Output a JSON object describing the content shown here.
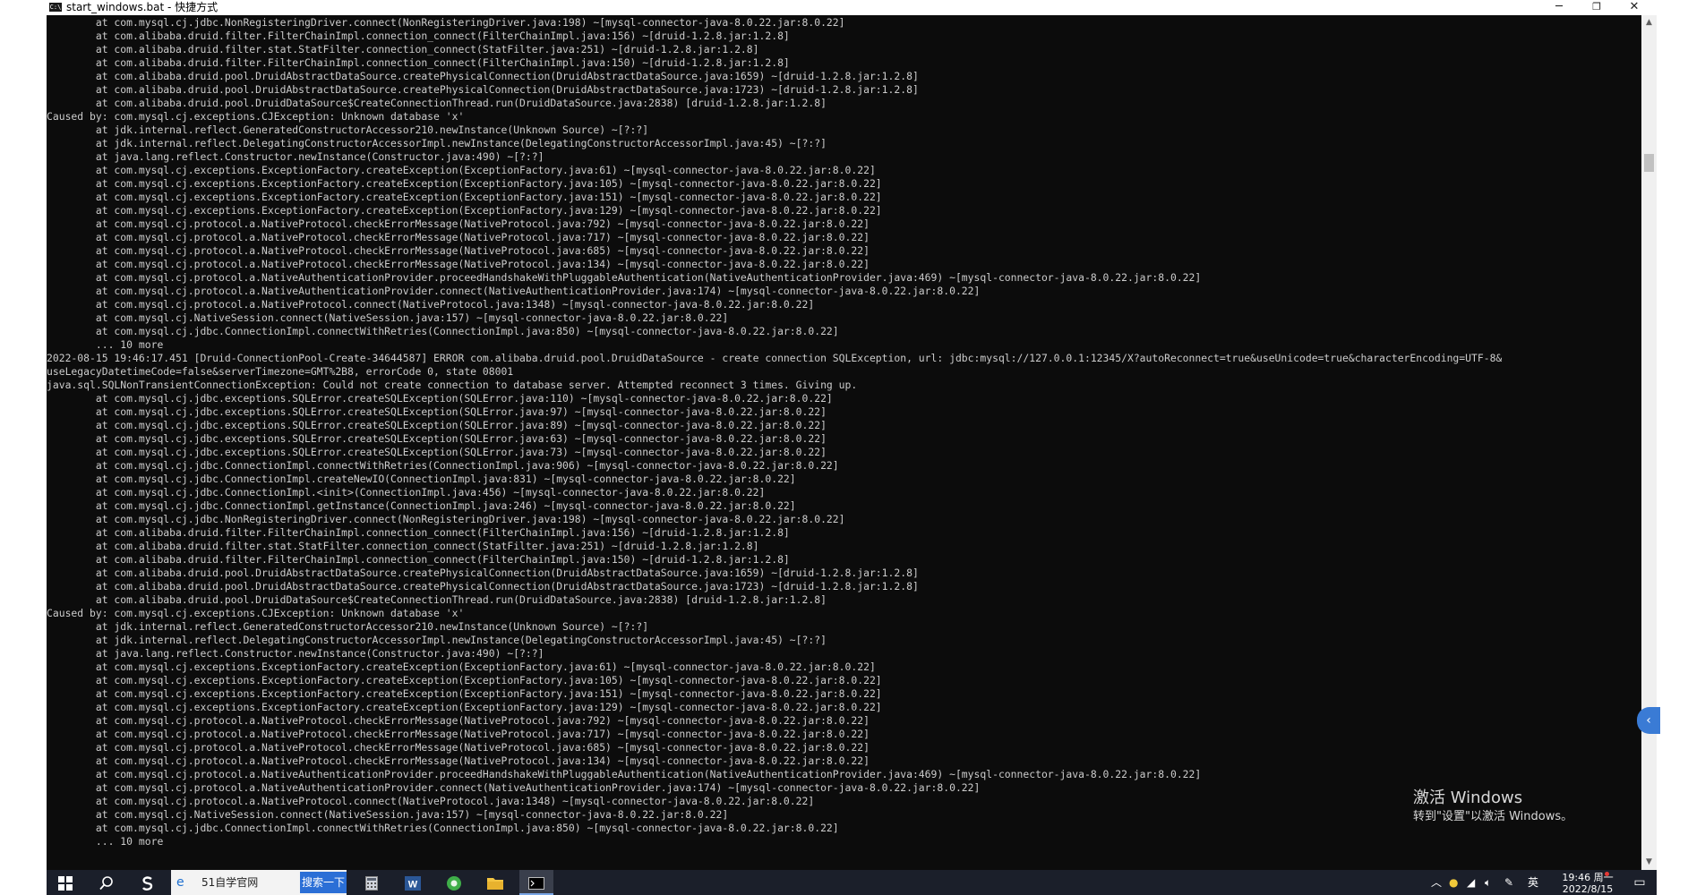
{
  "window": {
    "title": "start_windows.bat - 快捷方式",
    "icon_text": "C:\\",
    "controls": {
      "minimize": "─",
      "maximize": "❐",
      "close": "✕"
    }
  },
  "console": {
    "lines": [
      "        at com.mysql.cj.jdbc.NonRegisteringDriver.connect(NonRegisteringDriver.java:198) ~[mysql-connector-java-8.0.22.jar:8.0.22]",
      "        at com.alibaba.druid.filter.FilterChainImpl.connection_connect(FilterChainImpl.java:156) ~[druid-1.2.8.jar:1.2.8]",
      "        at com.alibaba.druid.filter.stat.StatFilter.connection_connect(StatFilter.java:251) ~[druid-1.2.8.jar:1.2.8]",
      "        at com.alibaba.druid.filter.FilterChainImpl.connection_connect(FilterChainImpl.java:150) ~[druid-1.2.8.jar:1.2.8]",
      "        at com.alibaba.druid.pool.DruidAbstractDataSource.createPhysicalConnection(DruidAbstractDataSource.java:1659) ~[druid-1.2.8.jar:1.2.8]",
      "        at com.alibaba.druid.pool.DruidAbstractDataSource.createPhysicalConnection(DruidAbstractDataSource.java:1723) ~[druid-1.2.8.jar:1.2.8]",
      "        at com.alibaba.druid.pool.DruidDataSource$CreateConnectionThread.run(DruidDataSource.java:2838) [druid-1.2.8.jar:1.2.8]",
      "Caused by: com.mysql.cj.exceptions.CJException: Unknown database 'x'",
      "        at jdk.internal.reflect.GeneratedConstructorAccessor210.newInstance(Unknown Source) ~[?:?]",
      "        at jdk.internal.reflect.DelegatingConstructorAccessorImpl.newInstance(DelegatingConstructorAccessorImpl.java:45) ~[?:?]",
      "        at java.lang.reflect.Constructor.newInstance(Constructor.java:490) ~[?:?]",
      "        at com.mysql.cj.exceptions.ExceptionFactory.createException(ExceptionFactory.java:61) ~[mysql-connector-java-8.0.22.jar:8.0.22]",
      "        at com.mysql.cj.exceptions.ExceptionFactory.createException(ExceptionFactory.java:105) ~[mysql-connector-java-8.0.22.jar:8.0.22]",
      "        at com.mysql.cj.exceptions.ExceptionFactory.createException(ExceptionFactory.java:151) ~[mysql-connector-java-8.0.22.jar:8.0.22]",
      "        at com.mysql.cj.exceptions.ExceptionFactory.createException(ExceptionFactory.java:129) ~[mysql-connector-java-8.0.22.jar:8.0.22]",
      "        at com.mysql.cj.protocol.a.NativeProtocol.checkErrorMessage(NativeProtocol.java:792) ~[mysql-connector-java-8.0.22.jar:8.0.22]",
      "        at com.mysql.cj.protocol.a.NativeProtocol.checkErrorMessage(NativeProtocol.java:717) ~[mysql-connector-java-8.0.22.jar:8.0.22]",
      "        at com.mysql.cj.protocol.a.NativeProtocol.checkErrorMessage(NativeProtocol.java:685) ~[mysql-connector-java-8.0.22.jar:8.0.22]",
      "        at com.mysql.cj.protocol.a.NativeProtocol.checkErrorMessage(NativeProtocol.java:134) ~[mysql-connector-java-8.0.22.jar:8.0.22]",
      "        at com.mysql.cj.protocol.a.NativeAuthenticationProvider.proceedHandshakeWithPluggableAuthentication(NativeAuthenticationProvider.java:469) ~[mysql-connector-java-8.0.22.jar:8.0.22]",
      "        at com.mysql.cj.protocol.a.NativeAuthenticationProvider.connect(NativeAuthenticationProvider.java:174) ~[mysql-connector-java-8.0.22.jar:8.0.22]",
      "        at com.mysql.cj.protocol.a.NativeProtocol.connect(NativeProtocol.java:1348) ~[mysql-connector-java-8.0.22.jar:8.0.22]",
      "        at com.mysql.cj.NativeSession.connect(NativeSession.java:157) ~[mysql-connector-java-8.0.22.jar:8.0.22]",
      "        at com.mysql.cj.jdbc.ConnectionImpl.connectWithRetries(ConnectionImpl.java:850) ~[mysql-connector-java-8.0.22.jar:8.0.22]",
      "        ... 10 more",
      "2022-08-15 19:46:17.451 [Druid-ConnectionPool-Create-34644587] ERROR com.alibaba.druid.pool.DruidDataSource - create connection SQLException, url: jdbc:mysql://127.0.0.1:12345/X?autoReconnect=true&useUnicode=true&characterEncoding=UTF-8&",
      "useLegacyDatetimeCode=false&serverTimezone=GMT%2B8, errorCode 0, state 08001",
      "java.sql.SQLNonTransientConnectionException: Could not create connection to database server. Attempted reconnect 3 times. Giving up.",
      "        at com.mysql.cj.jdbc.exceptions.SQLError.createSQLException(SQLError.java:110) ~[mysql-connector-java-8.0.22.jar:8.0.22]",
      "        at com.mysql.cj.jdbc.exceptions.SQLError.createSQLException(SQLError.java:97) ~[mysql-connector-java-8.0.22.jar:8.0.22]",
      "        at com.mysql.cj.jdbc.exceptions.SQLError.createSQLException(SQLError.java:89) ~[mysql-connector-java-8.0.22.jar:8.0.22]",
      "        at com.mysql.cj.jdbc.exceptions.SQLError.createSQLException(SQLError.java:63) ~[mysql-connector-java-8.0.22.jar:8.0.22]",
      "        at com.mysql.cj.jdbc.exceptions.SQLError.createSQLException(SQLError.java:73) ~[mysql-connector-java-8.0.22.jar:8.0.22]",
      "        at com.mysql.cj.jdbc.ConnectionImpl.connectWithRetries(ConnectionImpl.java:906) ~[mysql-connector-java-8.0.22.jar:8.0.22]",
      "        at com.mysql.cj.jdbc.ConnectionImpl.createNewIO(ConnectionImpl.java:831) ~[mysql-connector-java-8.0.22.jar:8.0.22]",
      "        at com.mysql.cj.jdbc.ConnectionImpl.<init>(ConnectionImpl.java:456) ~[mysql-connector-java-8.0.22.jar:8.0.22]",
      "        at com.mysql.cj.jdbc.ConnectionImpl.getInstance(ConnectionImpl.java:246) ~[mysql-connector-java-8.0.22.jar:8.0.22]",
      "        at com.mysql.cj.jdbc.NonRegisteringDriver.connect(NonRegisteringDriver.java:198) ~[mysql-connector-java-8.0.22.jar:8.0.22]",
      "        at com.alibaba.druid.filter.FilterChainImpl.connection_connect(FilterChainImpl.java:156) ~[druid-1.2.8.jar:1.2.8]",
      "        at com.alibaba.druid.filter.stat.StatFilter.connection_connect(StatFilter.java:251) ~[druid-1.2.8.jar:1.2.8]",
      "        at com.alibaba.druid.filter.FilterChainImpl.connection_connect(FilterChainImpl.java:150) ~[druid-1.2.8.jar:1.2.8]",
      "        at com.alibaba.druid.pool.DruidAbstractDataSource.createPhysicalConnection(DruidAbstractDataSource.java:1659) ~[druid-1.2.8.jar:1.2.8]",
      "        at com.alibaba.druid.pool.DruidAbstractDataSource.createPhysicalConnection(DruidAbstractDataSource.java:1723) ~[druid-1.2.8.jar:1.2.8]",
      "        at com.alibaba.druid.pool.DruidDataSource$CreateConnectionThread.run(DruidDataSource.java:2838) [druid-1.2.8.jar:1.2.8]",
      "Caused by: com.mysql.cj.exceptions.CJException: Unknown database 'x'",
      "        at jdk.internal.reflect.GeneratedConstructorAccessor210.newInstance(Unknown Source) ~[?:?]",
      "        at jdk.internal.reflect.DelegatingConstructorAccessorImpl.newInstance(DelegatingConstructorAccessorImpl.java:45) ~[?:?]",
      "        at java.lang.reflect.Constructor.newInstance(Constructor.java:490) ~[?:?]",
      "        at com.mysql.cj.exceptions.ExceptionFactory.createException(ExceptionFactory.java:61) ~[mysql-connector-java-8.0.22.jar:8.0.22]",
      "        at com.mysql.cj.exceptions.ExceptionFactory.createException(ExceptionFactory.java:105) ~[mysql-connector-java-8.0.22.jar:8.0.22]",
      "        at com.mysql.cj.exceptions.ExceptionFactory.createException(ExceptionFactory.java:151) ~[mysql-connector-java-8.0.22.jar:8.0.22]",
      "        at com.mysql.cj.exceptions.ExceptionFactory.createException(ExceptionFactory.java:129) ~[mysql-connector-java-8.0.22.jar:8.0.22]",
      "        at com.mysql.cj.protocol.a.NativeProtocol.checkErrorMessage(NativeProtocol.java:792) ~[mysql-connector-java-8.0.22.jar:8.0.22]",
      "        at com.mysql.cj.protocol.a.NativeProtocol.checkErrorMessage(NativeProtocol.java:717) ~[mysql-connector-java-8.0.22.jar:8.0.22]",
      "        at com.mysql.cj.protocol.a.NativeProtocol.checkErrorMessage(NativeProtocol.java:685) ~[mysql-connector-java-8.0.22.jar:8.0.22]",
      "        at com.mysql.cj.protocol.a.NativeProtocol.checkErrorMessage(NativeProtocol.java:134) ~[mysql-connector-java-8.0.22.jar:8.0.22]",
      "        at com.mysql.cj.protocol.a.NativeAuthenticationProvider.proceedHandshakeWithPluggableAuthentication(NativeAuthenticationProvider.java:469) ~[mysql-connector-java-8.0.22.jar:8.0.22]",
      "        at com.mysql.cj.protocol.a.NativeAuthenticationProvider.connect(NativeAuthenticationProvider.java:174) ~[mysql-connector-java-8.0.22.jar:8.0.22]",
      "        at com.mysql.cj.protocol.a.NativeProtocol.connect(NativeProtocol.java:1348) ~[mysql-connector-java-8.0.22.jar:8.0.22]",
      "        at com.mysql.cj.NativeSession.connect(NativeSession.java:157) ~[mysql-connector-java-8.0.22.jar:8.0.22]",
      "        at com.mysql.cj.jdbc.ConnectionImpl.connectWithRetries(ConnectionImpl.java:850) ~[mysql-connector-java-8.0.22.jar:8.0.22]",
      "        ... 10 more"
    ]
  },
  "watermark": {
    "title": "激活 Windows",
    "subtitle": "转到\"设置\"以激活 Windows。"
  },
  "taskbar": {
    "search": {
      "text": "51自学官网",
      "button": "搜索一下"
    },
    "tray": {
      "ime": "英",
      "time": "19:46 周一",
      "date": "2022/8/15"
    }
  },
  "icons": {
    "start": "windows-start-icon",
    "search": "search-icon",
    "side_handle": "chevron-left-icon"
  },
  "colors": {
    "console_bg": "#0c0c0c",
    "console_fg": "#cccccc",
    "taskbar_bg": "#1b1f2a",
    "search_button": "#2b6fd6"
  }
}
